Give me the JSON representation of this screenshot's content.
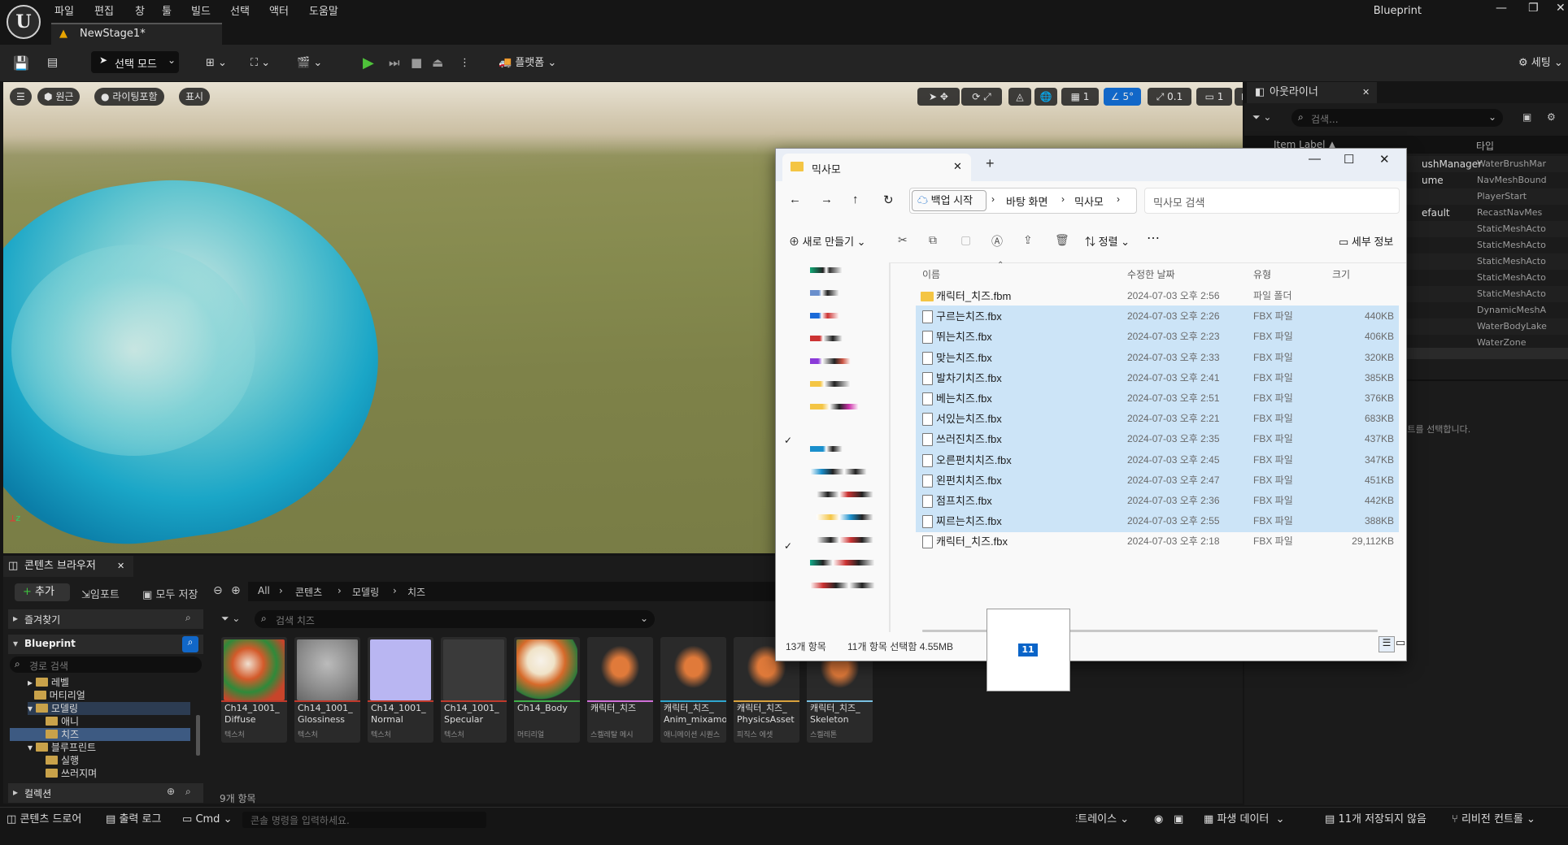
{
  "menu": [
    "파일",
    "편집",
    "창",
    "툴",
    "빌드",
    "선택",
    "액터",
    "도움말"
  ],
  "app_title": "Blueprint",
  "level_tab": "NewStage1*",
  "toolbar": {
    "mode": "선택 모드",
    "platforms": "플랫폼",
    "settings": "세팅"
  },
  "viewport": {
    "perspective": "원근",
    "lighting": "라이팅포함",
    "show": "표시",
    "angle": "5°",
    "scale": "0.1",
    "camera": "1",
    "grid": "1"
  },
  "outliner": {
    "tab": "아웃라이너",
    "search_placeholder": "검색...",
    "col_label": "Item Label ▲",
    "col_type": "타입",
    "rows": [
      {
        "label": "ushManager",
        "type": "WaterBrushMar"
      },
      {
        "label": "ume",
        "type": "NavMeshBound"
      },
      {
        "label": "",
        "type": "PlayerStart"
      },
      {
        "label": "efault",
        "type": "RecastNavMes"
      },
      {
        "label": "",
        "type": "StaticMeshActo"
      },
      {
        "label": "",
        "type": "StaticMeshActo"
      },
      {
        "label": "",
        "type": "StaticMeshActo"
      },
      {
        "label": "",
        "type": "StaticMeshActo"
      },
      {
        "label": "",
        "type": "StaticMeshActo"
      },
      {
        "label": "",
        "type": "DynamicMeshA"
      },
      {
        "label": "",
        "type": "WaterBodyLake"
      },
      {
        "label": "",
        "type": "WaterZone"
      }
    ],
    "details_hint": "오브젝트를 선택합니다."
  },
  "content_browser": {
    "tab": "콘텐츠 브라우저",
    "add": "추가",
    "import": "임포트",
    "save_all": "모두 저장",
    "breadcrumb": [
      "All",
      "콘텐츠",
      "모델링",
      "치즈"
    ],
    "favorites": "즐겨찾기",
    "root": "Blueprint",
    "path_search_placeholder": "경로 검색",
    "search_placeholder": "검색 치즈",
    "tree": [
      "레벨",
      "머티리얼",
      "모델링",
      "애니",
      "치즈",
      "블루프린트",
      "실행",
      "쓰러지며"
    ],
    "collections": "컬렉션",
    "item_count": "9개 항목",
    "assets": [
      {
        "name": "Ch14_1001_\nDiffuse",
        "type": "텍스처",
        "bar": "#c0392b"
      },
      {
        "name": "Ch14_1001_\nGlossiness",
        "type": "텍스처",
        "bar": "#c0392b"
      },
      {
        "name": "Ch14_1001_\nNormal",
        "type": "텍스처",
        "bar": "#c0392b"
      },
      {
        "name": "Ch14_1001_\nSpecular",
        "type": "텍스처",
        "bar": "#c0392b"
      },
      {
        "name": "Ch14_Body",
        "type": "머티리얼",
        "bar": "#3fae49"
      },
      {
        "name": "캐릭터_치즈",
        "type": "스켈레탈 메시",
        "bar": "#d070d8"
      },
      {
        "name": "캐릭터_치즈_\nAnim_mixamo",
        "type": "애니메이션 시퀀스",
        "bar": "#2fa7cf"
      },
      {
        "name": "캐릭터_치즈_\nPhysicsAsset",
        "type": "피직스 에셋",
        "bar": "#d9a23d"
      },
      {
        "name": "캐릭터_치즈_\nSkeleton",
        "type": "스켈레톤",
        "bar": "#7ac1e2"
      }
    ]
  },
  "statusbar": {
    "content_drawer": "콘텐츠 드로어",
    "output_log": "출력 로그",
    "cmd": "Cmd",
    "cmd_placeholder": "콘솔 명령을 입력하세요.",
    "trace": "트레이스",
    "derived_data": "파생 데이터",
    "unsaved": "11개 저장되지 않음",
    "revision": "리비전 컨트롤"
  },
  "explorer": {
    "tab_title": "믹사모",
    "backup": "백업 시작",
    "path": [
      "바탕 화면",
      "믹사모"
    ],
    "search_placeholder": "믹사모 검색",
    "new": "새로 만들기",
    "sort": "정렬",
    "details": "세부 정보",
    "columns": {
      "name": "이름",
      "date": "수정한 날짜",
      "type": "유형",
      "size": "크기"
    },
    "files": [
      {
        "name": "캐릭터_치즈.fbm",
        "date": "2024-07-03 오후 2:56",
        "type": "파일 폴더",
        "size": "",
        "folder": true,
        "selected": false
      },
      {
        "name": "구르는치즈.fbx",
        "date": "2024-07-03 오후 2:26",
        "type": "FBX 파일",
        "size": "440KB",
        "folder": false,
        "selected": true
      },
      {
        "name": "뛰는치즈.fbx",
        "date": "2024-07-03 오후 2:23",
        "type": "FBX 파일",
        "size": "406KB",
        "folder": false,
        "selected": true
      },
      {
        "name": "맞는치즈.fbx",
        "date": "2024-07-03 오후 2:33",
        "type": "FBX 파일",
        "size": "320KB",
        "folder": false,
        "selected": true
      },
      {
        "name": "발차기치즈.fbx",
        "date": "2024-07-03 오후 2:41",
        "type": "FBX 파일",
        "size": "385KB",
        "folder": false,
        "selected": true
      },
      {
        "name": "베는치즈.fbx",
        "date": "2024-07-03 오후 2:51",
        "type": "FBX 파일",
        "size": "376KB",
        "folder": false,
        "selected": true
      },
      {
        "name": "서있는치즈.fbx",
        "date": "2024-07-03 오후 2:21",
        "type": "FBX 파일",
        "size": "683KB",
        "folder": false,
        "selected": true
      },
      {
        "name": "쓰러진치즈.fbx",
        "date": "2024-07-03 오후 2:35",
        "type": "FBX 파일",
        "size": "437KB",
        "folder": false,
        "selected": true
      },
      {
        "name": "오른펀치치즈.fbx",
        "date": "2024-07-03 오후 2:45",
        "type": "FBX 파일",
        "size": "347KB",
        "folder": false,
        "selected": true
      },
      {
        "name": "왼펀치치즈.fbx",
        "date": "2024-07-03 오후 2:47",
        "type": "FBX 파일",
        "size": "451KB",
        "folder": false,
        "selected": true
      },
      {
        "name": "점프치즈.fbx",
        "date": "2024-07-03 오후 2:36",
        "type": "FBX 파일",
        "size": "442KB",
        "folder": false,
        "selected": true
      },
      {
        "name": "찌르는치즈.fbx",
        "date": "2024-07-03 오후 2:55",
        "type": "FBX 파일",
        "size": "388KB",
        "folder": false,
        "selected": true
      },
      {
        "name": "캐릭터_치즈.fbx",
        "date": "2024-07-03 오후 2:18",
        "type": "FBX 파일",
        "size": "29,112KB",
        "folder": false,
        "selected": false
      }
    ],
    "status_count": "13개 항목",
    "status_selected": "11개 항목 선택함 4.55MB",
    "drag_count": "11"
  }
}
